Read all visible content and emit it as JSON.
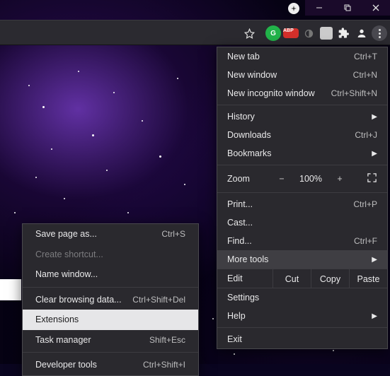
{
  "window_controls": {
    "minimize": "minimize-icon",
    "maximize": "maximize-icon",
    "close": "close-icon"
  },
  "toolbar": {
    "star": "bookmark-star-icon",
    "icons": [
      "g-extension",
      "abp-extension",
      "dim-extension",
      "square-extension",
      "puzzle-icon",
      "person-icon"
    ],
    "abp_label": "ABP",
    "g_label": "G",
    "kebab": "menu-button"
  },
  "menu": {
    "items": [
      {
        "label": "New tab",
        "shortcut": "Ctrl+T"
      },
      {
        "label": "New window",
        "shortcut": "Ctrl+N"
      },
      {
        "label": "New incognito window",
        "shortcut": "Ctrl+Shift+N"
      }
    ],
    "nav": [
      {
        "label": "History",
        "shortcut": "",
        "submenu": true
      },
      {
        "label": "Downloads",
        "shortcut": "Ctrl+J"
      },
      {
        "label": "Bookmarks",
        "shortcut": "",
        "submenu": true
      }
    ],
    "zoom": {
      "label": "Zoom",
      "minus": "−",
      "pct": "100%",
      "plus": "+",
      "fullscreen": "fullscreen-icon"
    },
    "printcast": [
      {
        "label": "Print...",
        "shortcut": "Ctrl+P"
      },
      {
        "label": "Cast...",
        "shortcut": ""
      },
      {
        "label": "Find...",
        "shortcut": "Ctrl+F"
      },
      {
        "label": "More tools",
        "shortcut": "",
        "submenu": true,
        "hover": true
      }
    ],
    "edit": {
      "label": "Edit",
      "cut": "Cut",
      "copy": "Copy",
      "paste": "Paste"
    },
    "bottom": [
      {
        "label": "Settings",
        "shortcut": ""
      },
      {
        "label": "Help",
        "shortcut": "",
        "submenu": true
      }
    ],
    "exit": {
      "label": "Exit"
    }
  },
  "submenu": {
    "items": [
      {
        "label": "Save page as...",
        "shortcut": "Ctrl+S"
      },
      {
        "label": "Create shortcut...",
        "shortcut": "",
        "disabled": true
      },
      {
        "label": "Name window...",
        "shortcut": ""
      }
    ],
    "items2": [
      {
        "label": "Clear browsing data...",
        "shortcut": "Ctrl+Shift+Del"
      },
      {
        "label": "Extensions",
        "shortcut": "",
        "hover": true
      },
      {
        "label": "Task manager",
        "shortcut": "Shift+Esc"
      }
    ],
    "items3": [
      {
        "label": "Developer tools",
        "shortcut": "Ctrl+Shift+I"
      }
    ]
  }
}
